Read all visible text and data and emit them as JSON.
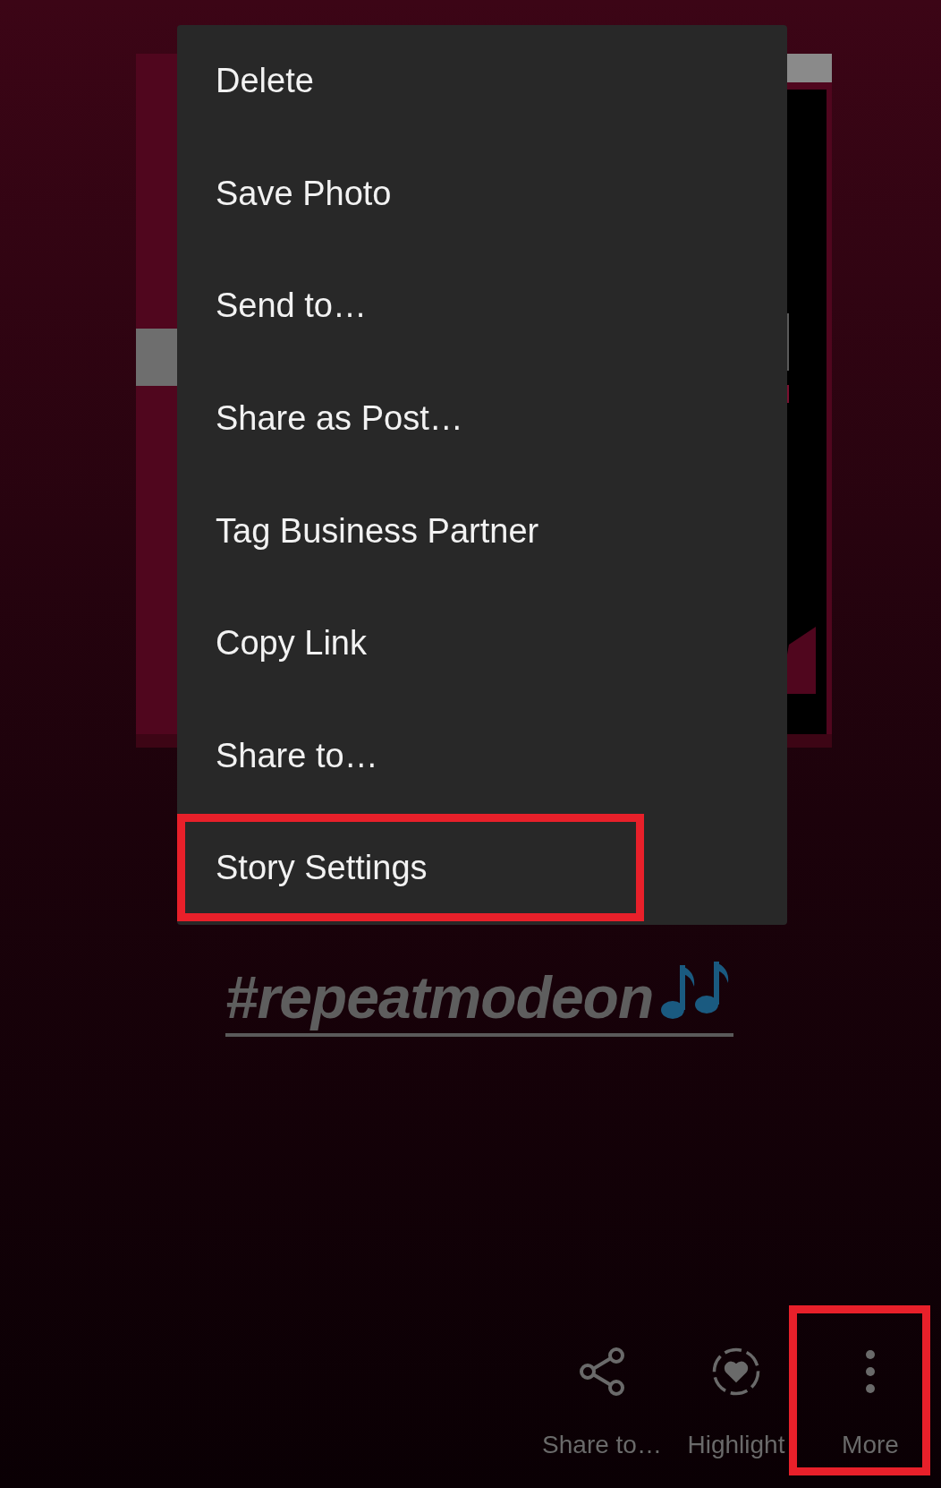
{
  "menu": {
    "items": [
      {
        "label": "Delete",
        "annotated": false
      },
      {
        "label": "Save Photo",
        "annotated": false
      },
      {
        "label": "Send to…",
        "annotated": false
      },
      {
        "label": "Share as Post…",
        "annotated": false
      },
      {
        "label": "Tag Business Partner",
        "annotated": false
      },
      {
        "label": "Copy Link",
        "annotated": false
      },
      {
        "label": "Share to…",
        "annotated": false
      },
      {
        "label": "Story Settings",
        "annotated": true
      }
    ]
  },
  "hashtag": "#repeatmodeon",
  "actions": [
    {
      "kind": "share",
      "label": "Share to…",
      "annotated": false
    },
    {
      "kind": "highlight",
      "label": "Highlight",
      "annotated": false
    },
    {
      "kind": "more",
      "label": "More",
      "annotated": true
    }
  ]
}
